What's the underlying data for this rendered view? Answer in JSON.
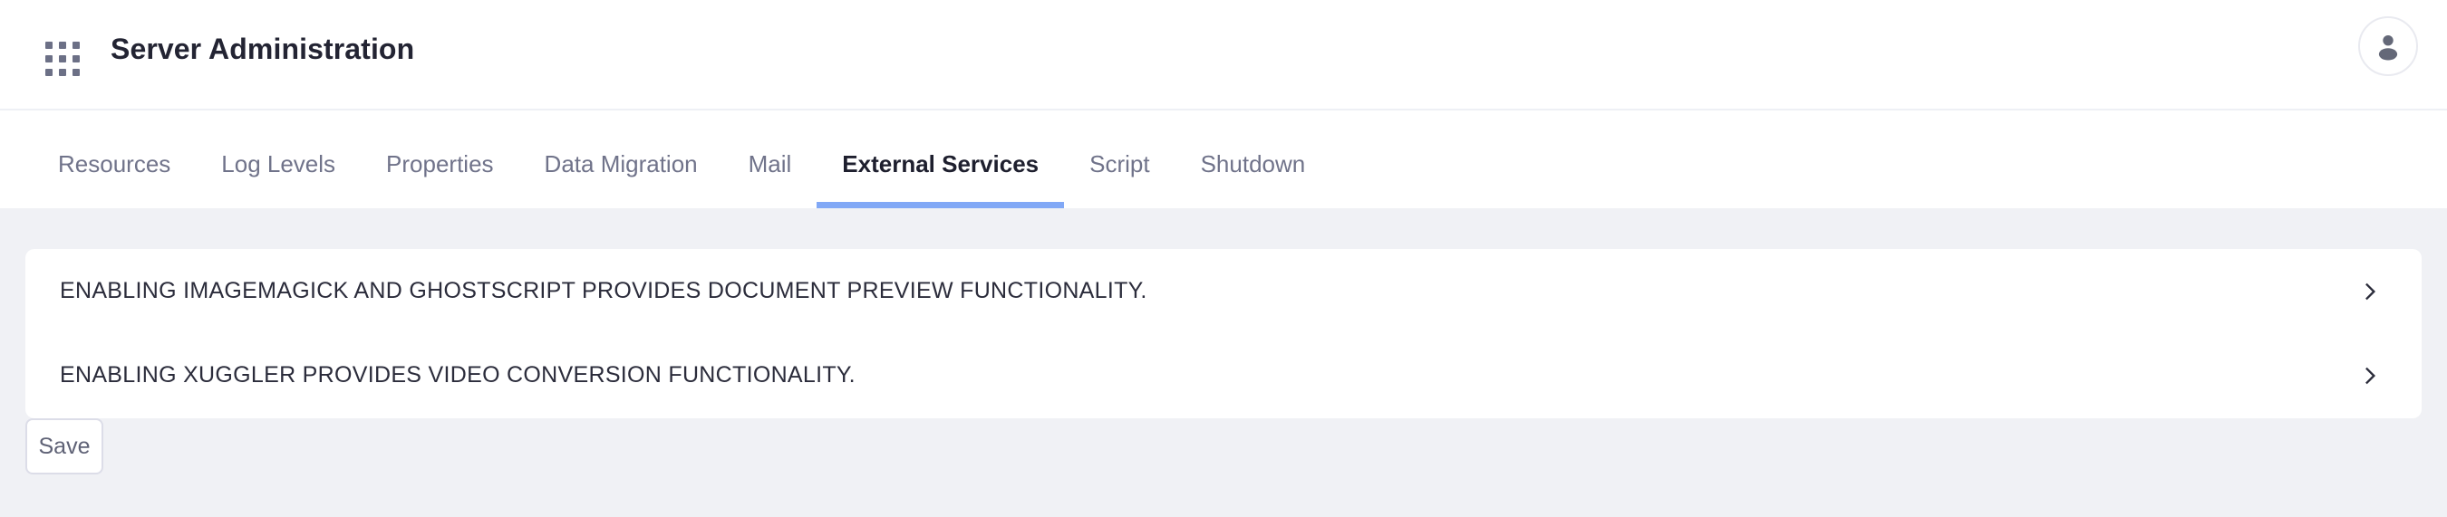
{
  "header": {
    "title": "Server Administration",
    "grid_icon": "grid-apps-icon",
    "avatar_icon": "user-avatar-icon"
  },
  "tabs": [
    {
      "label": "Resources",
      "active": false
    },
    {
      "label": "Log Levels",
      "active": false
    },
    {
      "label": "Properties",
      "active": false
    },
    {
      "label": "Data Migration",
      "active": false
    },
    {
      "label": "Mail",
      "active": false
    },
    {
      "label": "External Services",
      "active": true
    },
    {
      "label": "Script",
      "active": false
    },
    {
      "label": "Shutdown",
      "active": false
    }
  ],
  "panel": {
    "rows": [
      {
        "label": "ENABLING IMAGEMAGICK AND GHOSTSCRIPT PROVIDES DOCUMENT PREVIEW FUNCTIONALITY.",
        "expand_icon": "chevron-right-icon"
      },
      {
        "label": "ENABLING XUGGLER PROVIDES VIDEO CONVERSION FUNCTIONALITY.",
        "expand_icon": "chevron-right-icon"
      }
    ]
  },
  "actions": {
    "save_label": "Save"
  },
  "colors": {
    "page_background": "#f0f1f5",
    "panel_background": "#ffffff",
    "accent_underline": "#81a8f6",
    "title_text": "#232433",
    "tab_text": "#70738a",
    "icon_gray": "#6c7086"
  }
}
